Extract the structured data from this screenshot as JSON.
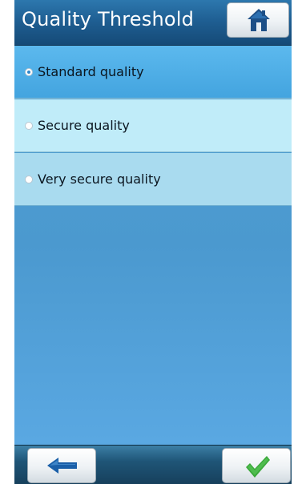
{
  "header": {
    "title": "Quality Threshold",
    "home_icon": "home-icon"
  },
  "options": [
    {
      "label": "Standard quality",
      "selected": true
    },
    {
      "label": "Secure quality",
      "selected": false
    },
    {
      "label": "Very secure quality",
      "selected": false
    }
  ],
  "footer": {
    "back_icon": "back-arrow-icon",
    "confirm_icon": "checkmark-icon"
  },
  "colors": {
    "header": "#1f5f93",
    "selected_row": "#4aaae4",
    "row_light": "#c0ecf9",
    "row_mid": "#a9dbef",
    "content_bg": "#4f9fd2",
    "back_arrow": "#1a5fa8",
    "checkmark": "#3aa83a"
  }
}
